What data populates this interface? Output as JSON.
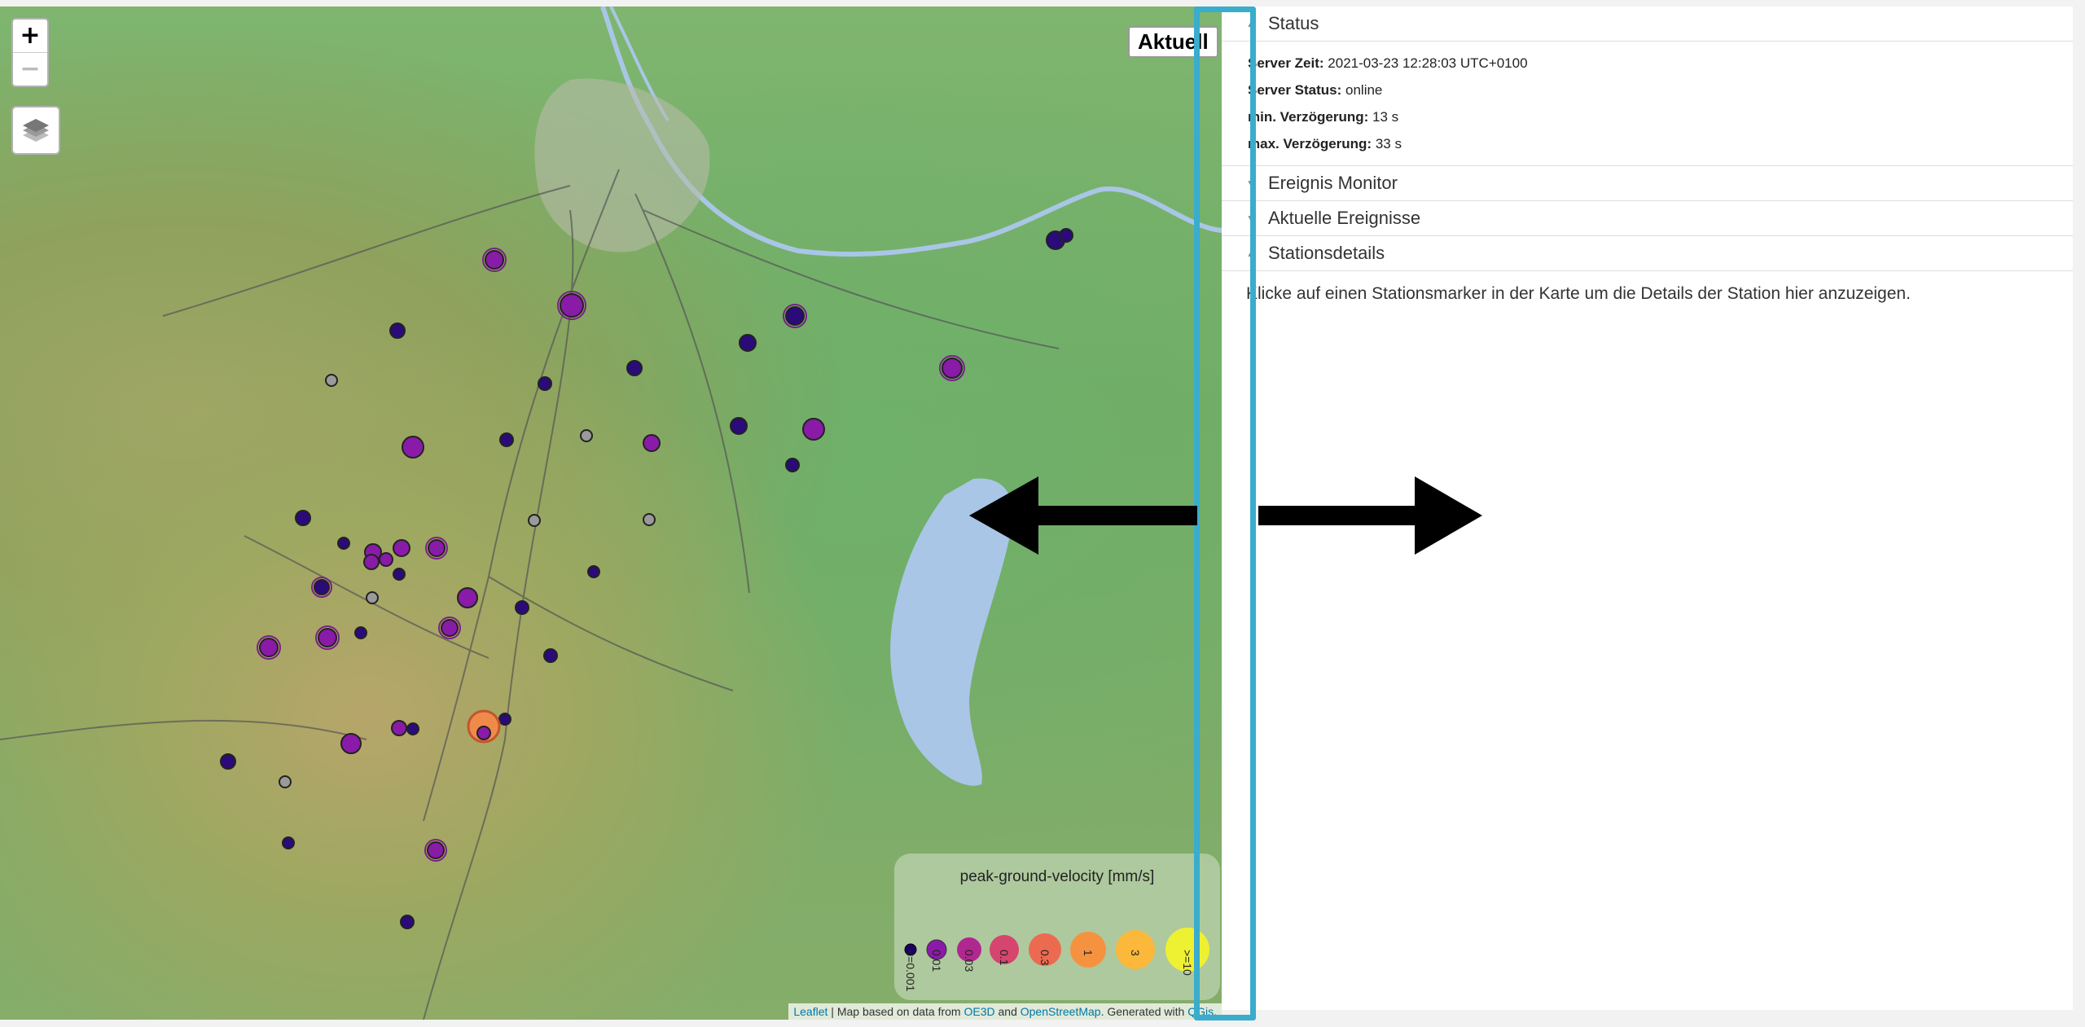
{
  "map": {
    "zoom_in_label": "+",
    "zoom_out_label": "−",
    "layers_icon": "layers-icon",
    "badge_label": "Aktuell",
    "colors": {
      "lake": "#a9c6e6",
      "river": "#a9c6e6",
      "road": "#555555",
      "station_dark": "#2b0a7a",
      "station_purple": "#8a1aa8",
      "station_gray": "#9a9a9a",
      "station_orange": "#f08a4b"
    },
    "legend": {
      "title": "peak-ground-velocity [mm/s]",
      "items": [
        {
          "label": "<=0.001",
          "color": "#1a0066"
        },
        {
          "label": "0.01",
          "color": "#8a1aa8"
        },
        {
          "label": "0.03",
          "color": "#b0288f"
        },
        {
          "label": "0.1",
          "color": "#d6456e"
        },
        {
          "label": "0.3",
          "color": "#ec6a50"
        },
        {
          "label": "1",
          "color": "#f5923f"
        },
        {
          "label": "3",
          "color": "#fbb83a"
        },
        {
          "label": ">=10",
          "color": "#eef032"
        }
      ]
    },
    "attribution": {
      "leaflet": "Leaflet",
      "text1": " | Map based on data from ",
      "oe3d": "OE3D",
      "text2": " and ",
      "osm": "OpenStreetMap",
      "text3": ". Generated with ",
      "qgis": "QGis",
      "text4": "."
    }
  },
  "sidebar": {
    "status": {
      "title": "Status",
      "server_time_label": "Server Zeit:",
      "server_time": "2021-03-23 12:28:03 UTC+0100",
      "server_status_label": "Server Status:",
      "server_status": "online",
      "min_delay_label": "min. Verzögerung:",
      "min_delay": "13 s",
      "max_delay_label": "max. Verzögerung:",
      "max_delay": "33 s"
    },
    "sections": [
      {
        "title": "Ereignis Monitor"
      },
      {
        "title": "Aktuelle Ereignisse"
      },
      {
        "title": "Stationsdetails"
      }
    ],
    "hint": "Klicke auf einen Stationsmarker in der Karte um die Details der Station hier anzuzeigen."
  }
}
